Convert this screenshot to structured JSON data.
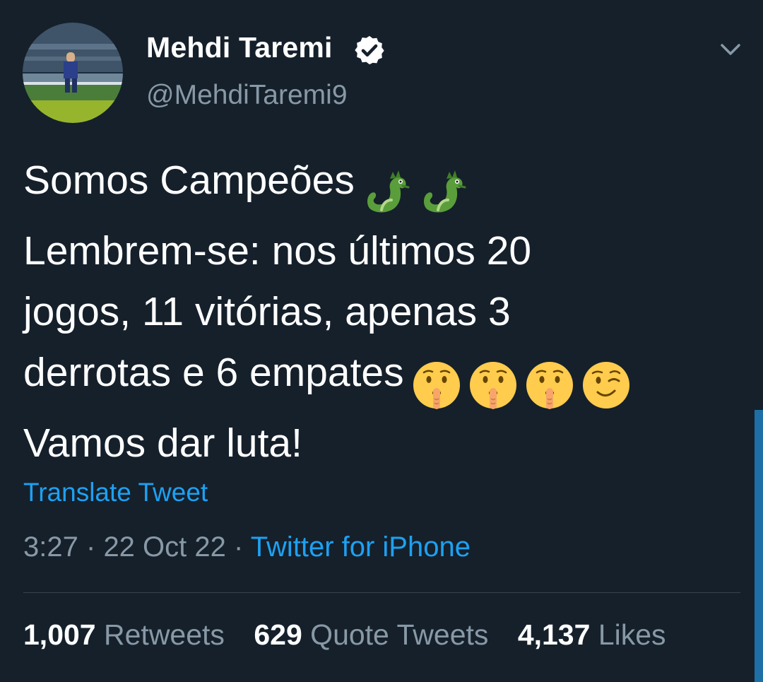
{
  "user": {
    "display_name": "Mehdi Taremi",
    "handle": "@MehdiTaremi9",
    "verified": true
  },
  "tweet": {
    "lines": [
      "Somos Campeões",
      "Lembrem-se: nos últimos 20",
      "jogos, 11 vitórias, apenas 3",
      "derrotas e 6 empates",
      "Vamos dar luta!"
    ],
    "line1_emojis": [
      "dragon-icon",
      "dragon-icon"
    ],
    "line4_emojis": [
      "shushing-face-icon",
      "shushing-face-icon",
      "shushing-face-icon",
      "winking-face-icon"
    ]
  },
  "translate_label": "Translate Tweet",
  "meta": {
    "time": "3:27",
    "date": "22 Oct 22",
    "separator": "·",
    "source": "Twitter for iPhone"
  },
  "stats": {
    "retweets": {
      "count": "1,007",
      "label": "Retweets"
    },
    "quote_tweets": {
      "count": "629",
      "label": "Quote Tweets"
    },
    "likes": {
      "count": "4,137",
      "label": "Likes"
    }
  },
  "colors": {
    "background": "#15202b",
    "accent": "#1da1f2",
    "secondary_text": "#8899a6"
  }
}
